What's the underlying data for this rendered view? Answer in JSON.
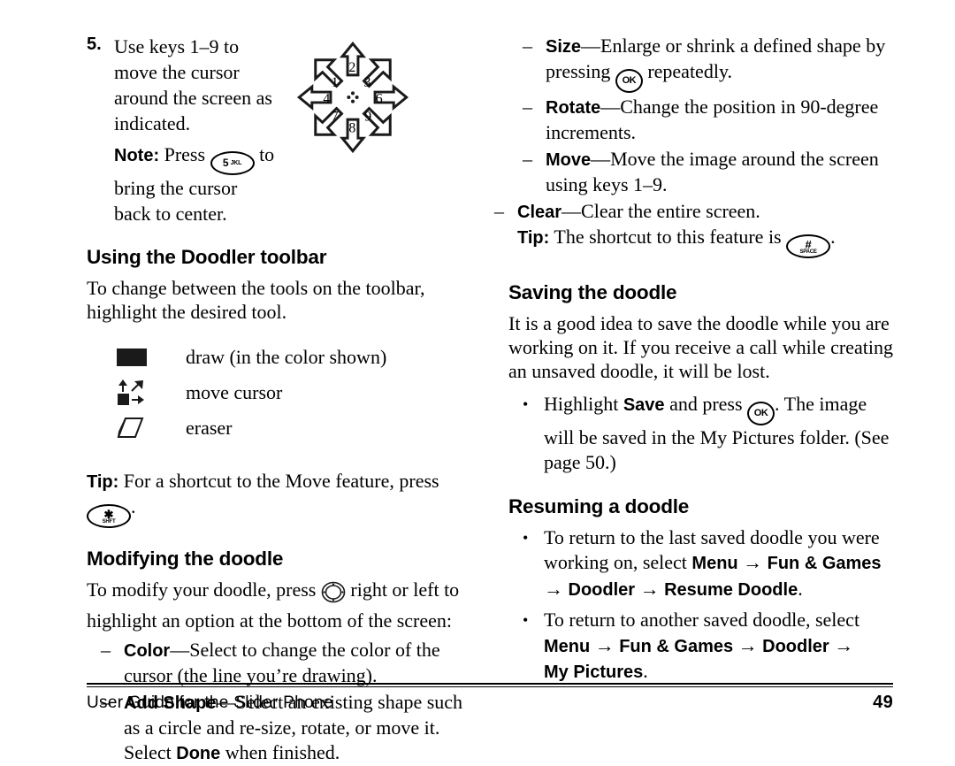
{
  "document": {
    "title": "User Guide for the Slider Phone",
    "page_number": "49"
  },
  "left_column": {
    "step": {
      "number": "5.",
      "text": "Use keys 1–9 to move the cursor around the screen as indicated.",
      "note_label": "Note:",
      "note_pre": "Press",
      "note_key_main": "5",
      "note_key_sub": "JKL",
      "note_post": "to bring the cursor back to center."
    },
    "diagram": {
      "name": "direction-keys-diagram",
      "labels": [
        "1",
        "2",
        "3",
        "4",
        "6",
        "7",
        "8",
        "9"
      ],
      "center": "cursor-dot"
    },
    "heading_toolbar": "Using the Doodler toolbar",
    "toolbar_intro": "To change between the tools on the toolbar, highlight the desired tool.",
    "tools": [
      {
        "icon": "filled-rectangle-icon",
        "label": "draw (in the color shown)"
      },
      {
        "icon": "move-cursor-icon",
        "label": "move cursor"
      },
      {
        "icon": "eraser-icon",
        "label": "eraser"
      }
    ],
    "tip": {
      "label": "Tip:",
      "text_before": "For a shortcut to the Move feature, press",
      "key_main": "✱",
      "key_sub": "SHFT",
      "text_after": "."
    },
    "heading_modifying": "Modifying the doodle",
    "modify_intro_pre": "To modify your doodle, press",
    "modify_intro_post": "right or left to highlight an option at the bottom of the screen:",
    "modify_items": [
      {
        "marker": "–",
        "term": "Color",
        "desc": "—Select to change the color of the cursor (the line you’re drawing)."
      },
      {
        "marker": "–",
        "term": "Add Shape",
        "desc": "—Select an existing shape such as a circle and re-size, rotate, or move it. Select",
        "term2": "Done",
        "desc2": "when finished."
      }
    ]
  },
  "right_column": {
    "modify_items_continued": [
      {
        "marker": "–",
        "term": "Size",
        "desc_before": "—Enlarge or shrink a defined shape by pressing",
        "key": "OK",
        "desc_after": "repeatedly."
      },
      {
        "marker": "–",
        "term": "Rotate",
        "desc": "—Change the position in 90-degree increments."
      },
      {
        "marker": "–",
        "term": "Move",
        "desc": "—Move the image around the screen using keys 1–9."
      }
    ],
    "clear_item": {
      "marker": "–",
      "term": "Clear",
      "desc": "—Clear the entire screen.",
      "tip_label": "Tip:",
      "tip_text": "The shortcut to this feature is",
      "tip_key_main": "#",
      "tip_key_sub": "SPACE",
      "tip_after": "."
    },
    "heading_saving": "Saving the doodle",
    "saving_intro": "It is a good idea to save the doodle while you are working on it. If you receive a call while creating an unsaved doodle, it will be lost.",
    "saving_bullet": {
      "marker": "•",
      "text_before": "Highlight",
      "term": "Save",
      "text_mid": "and press",
      "key": "OK",
      "text_after": ". The image will be saved in the My Pictures folder. (See page 50.)"
    },
    "heading_resuming": "Resuming a doodle",
    "resuming_bullets": [
      {
        "marker": "•",
        "text_before": "To return to the last saved doodle you were working on, select",
        "path": [
          "Menu",
          "Fun & Games",
          "Doodler",
          "Resume Doodle"
        ],
        "text_after": "."
      },
      {
        "marker": "•",
        "text_before": "To return to another saved doodle, select",
        "path": [
          "Menu",
          "Fun & Games",
          "Doodler",
          "My Pictures"
        ],
        "text_after": "."
      }
    ]
  },
  "colors": {
    "text": "#000000",
    "background": "#ffffff"
  }
}
